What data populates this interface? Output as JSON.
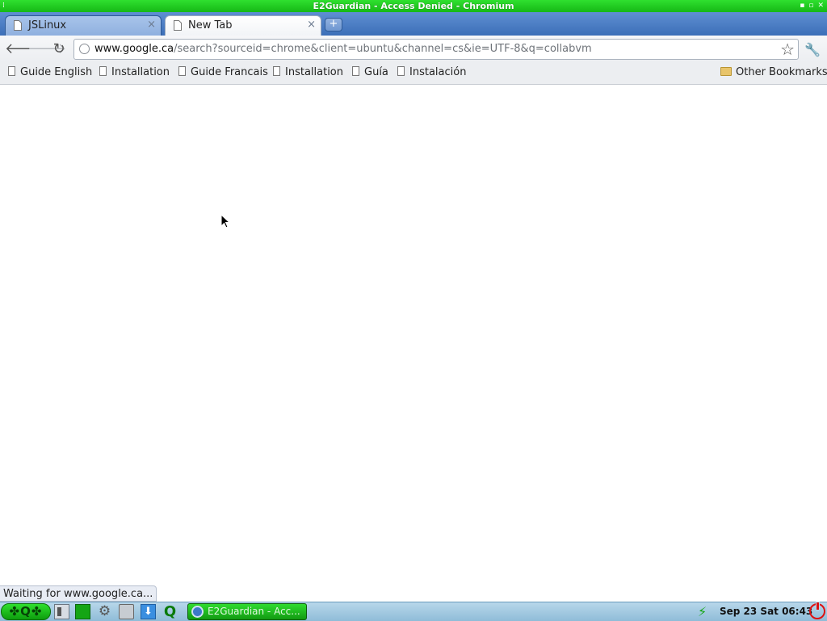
{
  "window": {
    "title": "E2Guardian - Access Denied - Chromium",
    "minimize_glyph": "▪",
    "maximize_glyph": "▫",
    "close_glyph": "✕"
  },
  "tabs": [
    {
      "label": "JSLinux",
      "active": false,
      "close": "×"
    },
    {
      "label": "New Tab",
      "active": true,
      "close": "×"
    }
  ],
  "new_tab_button": "+",
  "toolbar": {
    "back_icon": "🡐",
    "forward_icon": "🡒",
    "reload_icon": "↻",
    "url_host": "www.google.ca",
    "url_path": "/search?sourceid=chrome&client=ubuntu&channel=cs&ie=UTF-8&q=collabvm",
    "star_icon": "☆",
    "wrench_icon": "🔧"
  },
  "bookmarks": {
    "items": [
      "Guide English",
      "Installation",
      "Guide Francais",
      "Installation",
      "Guía",
      "Instalación"
    ],
    "other": "Other Bookmarks"
  },
  "status": {
    "text": "Waiting for www.google.ca..."
  },
  "taskbar": {
    "start_label": "✤Q✤",
    "window_button": "E2Guardian - Acc...",
    "clock": "Sep 23 Sat 06:43",
    "colors": {
      "accent": "#16b816",
      "taskbar": "#8fbcd8",
      "power": "#dd1111"
    }
  }
}
